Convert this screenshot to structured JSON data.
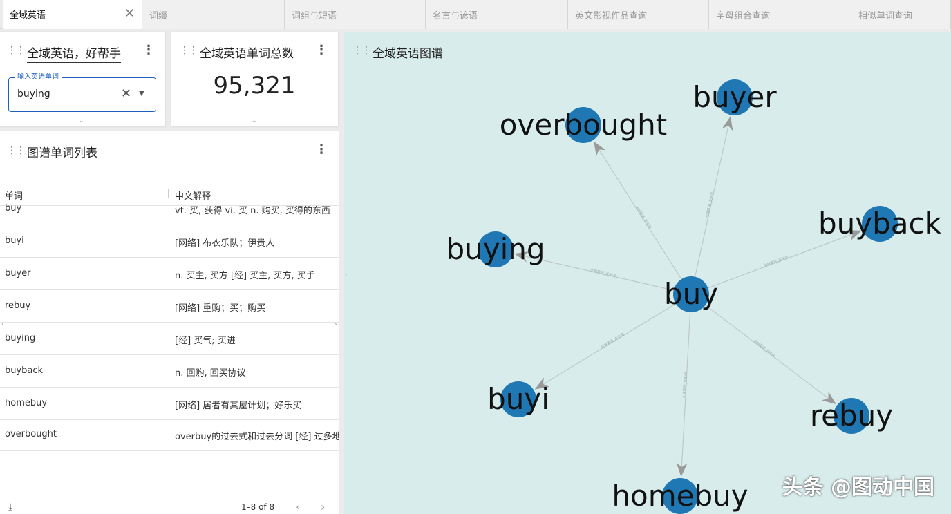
{
  "tabs": [
    {
      "label": "全域英语",
      "active": true
    },
    {
      "label": "词缀"
    },
    {
      "label": "词组与短语"
    },
    {
      "label": "名言与谚语"
    },
    {
      "label": "英文影视作品查询"
    },
    {
      "label": "字母组合查询"
    },
    {
      "label": "相似单词查询"
    }
  ],
  "search_panel": {
    "title": "全域英语，好帮手",
    "input_label": "输入英语单词",
    "input_value": "buying"
  },
  "count_panel": {
    "title": "全域英语单词总数",
    "value": "95,321"
  },
  "list_panel": {
    "title": "图谱单词列表",
    "columns": [
      "单词",
      "中文解释"
    ],
    "rows": [
      {
        "word": "buy",
        "meaning": "vt. 买, 获得 vi. 买 n. 购买, 买得的东西"
      },
      {
        "word": "buyi",
        "meaning": "[网络] 布衣乐队；伊贵人"
      },
      {
        "word": "buyer",
        "meaning": "n. 买主, 买方 [经] 买主, 买方, 买手"
      },
      {
        "word": "rebuy",
        "meaning": "[网络] 重购；买；购买"
      },
      {
        "word": "buying",
        "meaning": "[经] 买气; 买进"
      },
      {
        "word": "buyback",
        "meaning": "n. 回购, 回买协议"
      },
      {
        "word": "homebuy",
        "meaning": "[网络] 居者有其屋计划；好乐买"
      },
      {
        "word": "overbought",
        "meaning": "overbuy的过去式和过去分词 [经] 过多地买"
      }
    ],
    "pagination": "1–8 of 8"
  },
  "graph_panel": {
    "title": "全域英语图谱",
    "center": "buy",
    "nodes": [
      "overbought",
      "buyer",
      "buyback",
      "buying",
      "buy",
      "buyi",
      "rebuy",
      "homebuy"
    ],
    "node_color": "#1f77b4",
    "edge_label": "全域英语_派生词"
  },
  "watermark": "头条 @图动中国"
}
